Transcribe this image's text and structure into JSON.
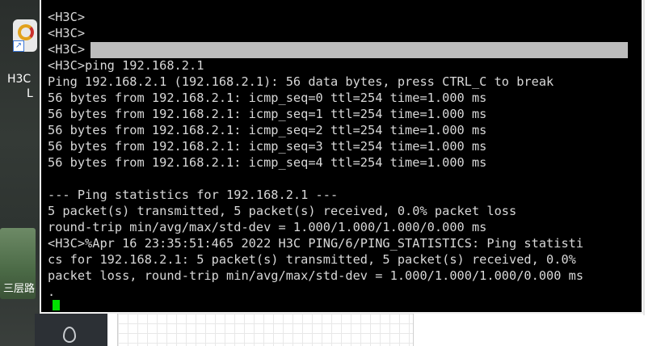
{
  "desktop": {
    "icon_label": "H3C",
    "icon_label_second": "L",
    "folder_label": "三层路"
  },
  "terminal": {
    "lines": [
      "<H3C>",
      "<H3C>",
      "<H3C>",
      "<H3C>ping 192.168.2.1",
      "Ping 192.168.2.1 (192.168.2.1): 56 data bytes, press CTRL_C to break",
      "56 bytes from 192.168.2.1: icmp_seq=0 ttl=254 time=1.000 ms",
      "56 bytes from 192.168.2.1: icmp_seq=1 ttl=254 time=1.000 ms",
      "56 bytes from 192.168.2.1: icmp_seq=2 ttl=254 time=1.000 ms",
      "56 bytes from 192.168.2.1: icmp_seq=3 ttl=254 time=1.000 ms",
      "56 bytes from 192.168.2.1: icmp_seq=4 ttl=254 time=1.000 ms",
      "",
      "--- Ping statistics for 192.168.2.1 ---",
      "5 packet(s) transmitted, 5 packet(s) received, 0.0% packet loss",
      "round-trip min/avg/max/std-dev = 1.000/1.000/1.000/0.000 ms",
      "<H3C>%Apr 16 23:35:51:465 2022 H3C PING/6/PING_STATISTICS: Ping statisti",
      "cs for 192.168.2.1: 5 packet(s) transmitted, 5 packet(s) received, 0.0%",
      "packet loss, round-trip min/avg/max/std-dev = 1.000/1.000/1.000/0.000 ms",
      "."
    ],
    "colors": {
      "background": "#000000",
      "text": "#d8d8d8",
      "cursor": "#00e000",
      "selection": "#bdbdbd"
    }
  },
  "icons": [
    "h3c-app-icon",
    "shortcut-arrow-icon",
    "location-pin-icon"
  ]
}
